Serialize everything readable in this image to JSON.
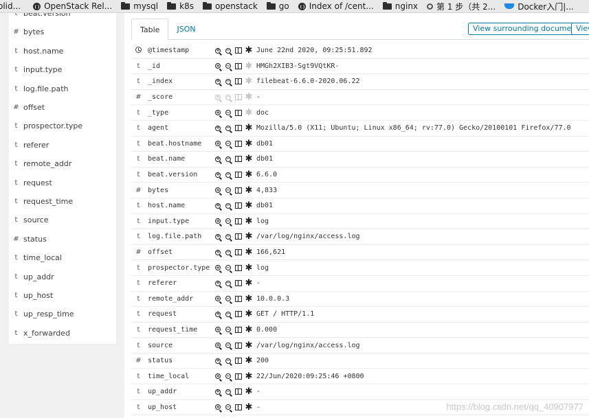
{
  "bookmarks": [
    {
      "icon": "none",
      "label": "olid..."
    },
    {
      "icon": "globe",
      "label": "OpenStack Rel..."
    },
    {
      "icon": "folder",
      "label": "mysql"
    },
    {
      "icon": "folder",
      "label": "k8s"
    },
    {
      "icon": "folder",
      "label": "openstack"
    },
    {
      "icon": "folder",
      "label": "go"
    },
    {
      "icon": "globe",
      "label": "Index of /cent..."
    },
    {
      "icon": "folder",
      "label": "nginx"
    },
    {
      "icon": "gear",
      "label": "第 1 步（共 2..."
    },
    {
      "icon": "docker",
      "label": "Docker入门|..."
    }
  ],
  "sidebar": {
    "items": [
      {
        "type": "t",
        "name": "beat.version"
      },
      {
        "type": "#",
        "name": "bytes"
      },
      {
        "type": "t",
        "name": "host.name"
      },
      {
        "type": "t",
        "name": "input.type"
      },
      {
        "type": "t",
        "name": "log.file.path"
      },
      {
        "type": "#",
        "name": "offset"
      },
      {
        "type": "t",
        "name": "prospector.type"
      },
      {
        "type": "t",
        "name": "referer"
      },
      {
        "type": "t",
        "name": "remote_addr"
      },
      {
        "type": "t",
        "name": "request"
      },
      {
        "type": "t",
        "name": "request_time"
      },
      {
        "type": "t",
        "name": "source"
      },
      {
        "type": "#",
        "name": "status"
      },
      {
        "type": "t",
        "name": "time_local"
      },
      {
        "type": "t",
        "name": "up_addr"
      },
      {
        "type": "t",
        "name": "up_host"
      },
      {
        "type": "t",
        "name": "up_resp_time"
      },
      {
        "type": "t",
        "name": "x_forwarded"
      }
    ]
  },
  "doc": {
    "tabs": {
      "table": "Table",
      "json": "JSON"
    },
    "surrounding_label": "View surrounding documents",
    "single_label": "View single document",
    "rows": [
      {
        "type": "clock",
        "field": "@timestamp",
        "value": "June 22nd 2020, 09:25:51.892",
        "dim": false,
        "star_dim": false
      },
      {
        "type": "t",
        "field": "_id",
        "value": "HMGh2XIB3-Sgt9VQtKR-",
        "dim": false,
        "star_dim": true
      },
      {
        "type": "t",
        "field": "_index",
        "value": "filebeat-6.6.0-2020.06.22",
        "dim": false,
        "star_dim": true
      },
      {
        "type": "#",
        "field": "_score",
        "value": " -",
        "dim": true,
        "star_dim": true
      },
      {
        "type": "t",
        "field": "_type",
        "value": "doc",
        "dim": false,
        "star_dim": true
      },
      {
        "type": "t",
        "field": "agent",
        "value": "Mozilla/5.0 (X11; Ubuntu; Linux x86_64; rv:77.0) Gecko/20100101 Firefox/77.0",
        "dim": false,
        "star_dim": false
      },
      {
        "type": "t",
        "field": "beat.hostname",
        "value": "db01",
        "dim": false,
        "star_dim": false
      },
      {
        "type": "t",
        "field": "beat.name",
        "value": "db01",
        "dim": false,
        "star_dim": false
      },
      {
        "type": "t",
        "field": "beat.version",
        "value": "6.6.0",
        "dim": false,
        "star_dim": false
      },
      {
        "type": "#",
        "field": "bytes",
        "value": "4,833",
        "dim": false,
        "star_dim": false
      },
      {
        "type": "t",
        "field": "host.name",
        "value": "db01",
        "dim": false,
        "star_dim": false
      },
      {
        "type": "t",
        "field": "input.type",
        "value": "log",
        "dim": false,
        "star_dim": false
      },
      {
        "type": "t",
        "field": "log.file.path",
        "value": "/var/log/nginx/access.log",
        "dim": false,
        "star_dim": false
      },
      {
        "type": "#",
        "field": "offset",
        "value": "166,621",
        "dim": false,
        "star_dim": false
      },
      {
        "type": "t",
        "field": "prospector.type",
        "value": "log",
        "dim": false,
        "star_dim": false
      },
      {
        "type": "t",
        "field": "referer",
        "value": "-",
        "dim": false,
        "star_dim": false
      },
      {
        "type": "t",
        "field": "remote_addr",
        "value": "10.0.0.3",
        "dim": false,
        "star_dim": false
      },
      {
        "type": "t",
        "field": "request",
        "value": "GET / HTTP/1.1",
        "dim": false,
        "star_dim": false
      },
      {
        "type": "t",
        "field": "request_time",
        "value": "0.000",
        "dim": false,
        "star_dim": false
      },
      {
        "type": "t",
        "field": "source",
        "value": "/var/log/nginx/access.log",
        "dim": false,
        "star_dim": false
      },
      {
        "type": "#",
        "field": "status",
        "value": "200",
        "dim": false,
        "star_dim": false
      },
      {
        "type": "t",
        "field": "time_local",
        "value": "22/Jun/2020:09:25:46 +0800",
        "dim": false,
        "star_dim": false
      },
      {
        "type": "t",
        "field": "up_addr",
        "value": "-",
        "dim": false,
        "star_dim": false
      },
      {
        "type": "t",
        "field": "up_host",
        "value": "-",
        "dim": false,
        "star_dim": false
      }
    ]
  },
  "watermark": "https://blog.csdn.net/qq_40907977"
}
